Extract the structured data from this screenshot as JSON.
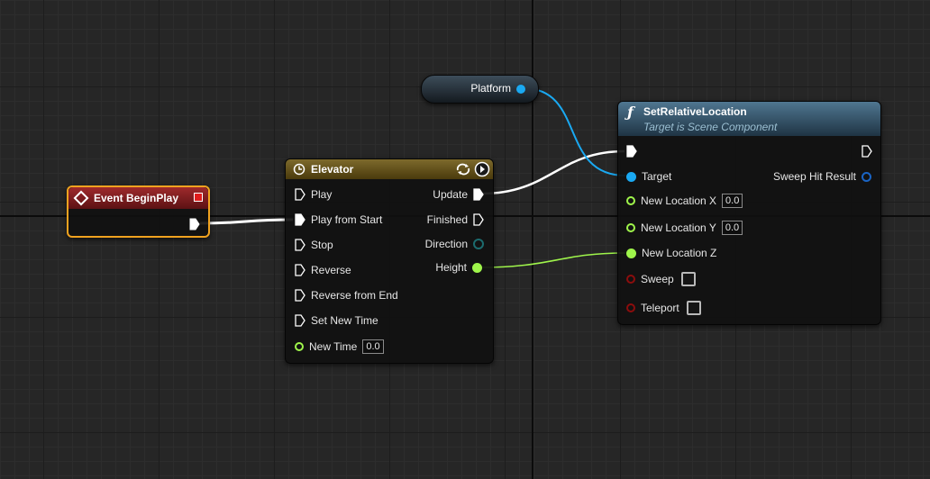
{
  "colors": {
    "exec": "#ffffff",
    "object": "#1aa9f2",
    "float": "#9ff54b",
    "struct": "#1c5a5e",
    "bool": "#8c0d0d",
    "timeline_header": "#6b5417",
    "event_header": "#8c1518",
    "function_header": "#35586f",
    "variable_node": "#2b3b48"
  },
  "event_node": {
    "title": "Event BeginPlay",
    "icon": "event-diamond-icon",
    "delegate_icon": "delegate-square-icon"
  },
  "timeline_node": {
    "title": "Elevator",
    "icon": "clock-icon",
    "loop_icon": "loop-icon",
    "play_icon": "play-circle-icon",
    "inputs": [
      {
        "label": "Play"
      },
      {
        "label": "Play from Start"
      },
      {
        "label": "Stop"
      },
      {
        "label": "Reverse"
      },
      {
        "label": "Reverse from End"
      },
      {
        "label": "Set New Time"
      }
    ],
    "new_time": {
      "label": "New Time",
      "value": "0.0"
    },
    "outputs": [
      {
        "label": "Update"
      },
      {
        "label": "Finished"
      },
      {
        "label": "Direction"
      },
      {
        "label": "Height"
      }
    ]
  },
  "variable_node": {
    "label": "Platform"
  },
  "function_node": {
    "icon": "function-f-icon",
    "title": "SetRelativeLocation",
    "subtitle": "Target is Scene Component",
    "target_label": "Target",
    "sweep_hit_label": "Sweep Hit Result",
    "new_location_x": {
      "label": "New Location X",
      "value": "0.0"
    },
    "new_location_y": {
      "label": "New Location Y",
      "value": "0.0"
    },
    "new_location_z": {
      "label": "New Location Z"
    },
    "sweep_label": "Sweep",
    "teleport_label": "Teleport"
  }
}
